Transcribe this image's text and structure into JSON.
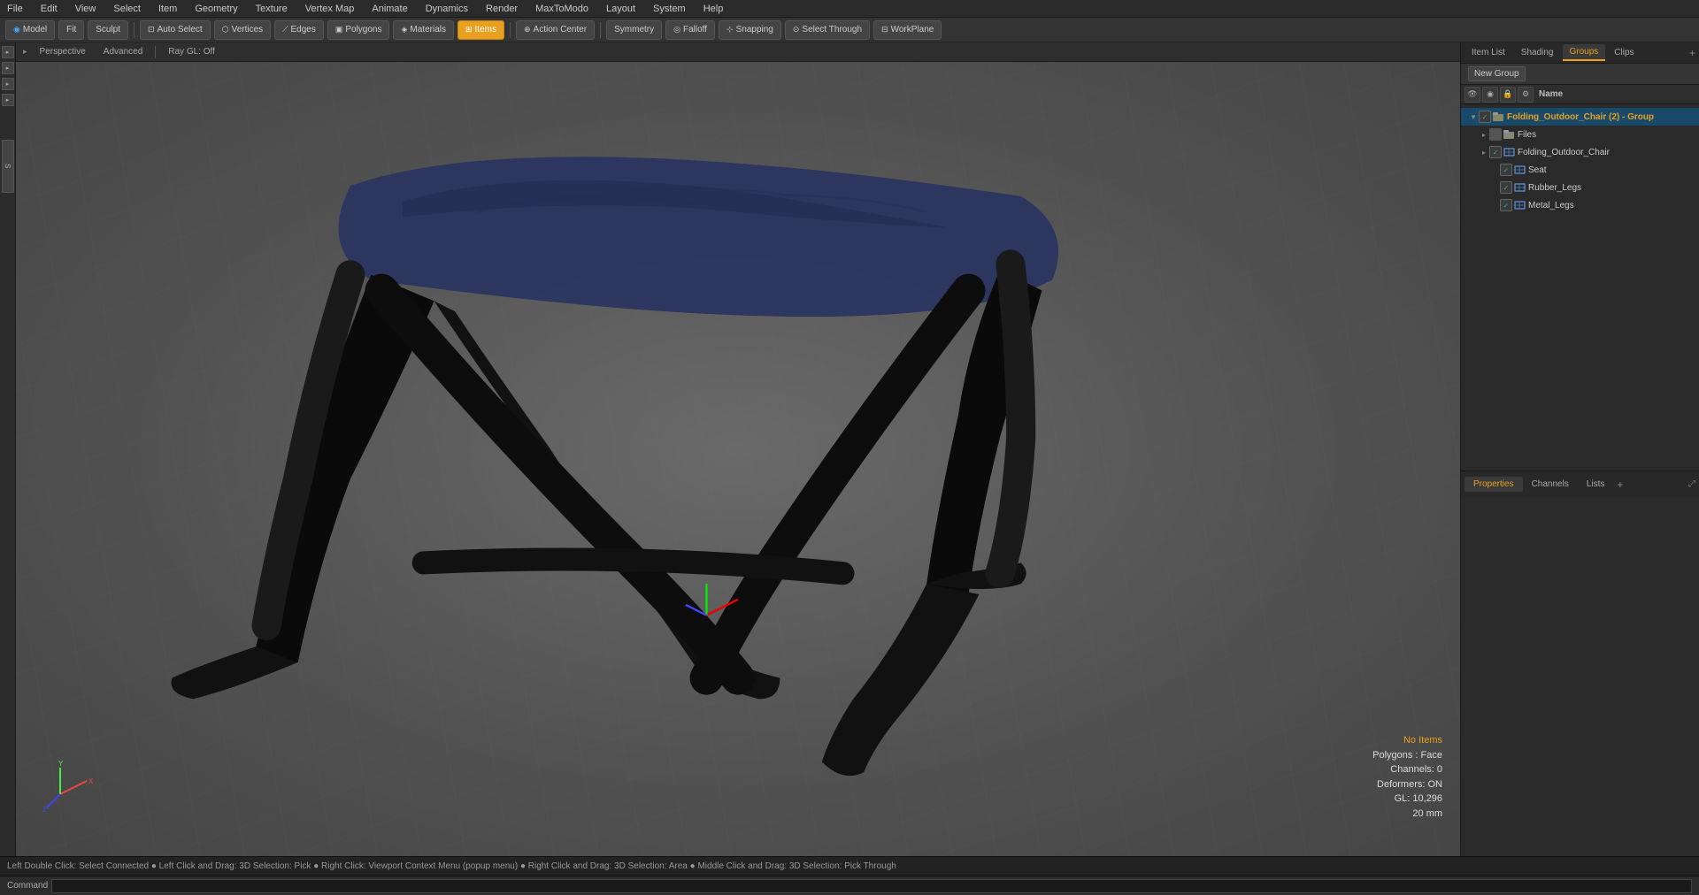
{
  "menu": {
    "items": [
      "File",
      "Edit",
      "View",
      "Select",
      "Item",
      "Geometry",
      "Texture",
      "Vertex Map",
      "Animate",
      "Dynamics",
      "Render",
      "MaxToModo",
      "Layout",
      "System",
      "Help"
    ]
  },
  "toolbar": {
    "mode_model": "Model",
    "mode_fit": "Fit",
    "mode_sculpt": "Sculpt",
    "auto_select": "Auto Select",
    "vertices": "Vertices",
    "edges": "Edges",
    "polygons": "Polygons",
    "materials": "Materials",
    "items": "Items",
    "action_center": "Action Center",
    "symmetry": "Symmetry",
    "falloff": "Falloff",
    "snapping": "Snapping",
    "select_through": "Select Through",
    "workplane": "WorkPlane"
  },
  "sub_toolbar": {
    "perspective": "Perspective",
    "advanced": "Advanced",
    "ray_gl": "Ray GL: Off"
  },
  "viewport": {
    "no_items": "No Items",
    "polygons": "Polygons : Face",
    "channels": "Channels: 0",
    "deformers": "Deformers: ON",
    "gl": "GL: 10,296",
    "size": "20 mm"
  },
  "status_bar": {
    "text": "Left Double Click: Select Connected ● Left Click and Drag: 3D Selection: Pick ● Right Click: Viewport Context Menu (popup menu) ● Right Click and Drag: 3D Selection: Area ● Middle Click and Drag: 3D Selection: Pick Through"
  },
  "command_bar": {
    "label": "Command",
    "placeholder": ""
  },
  "right_panel": {
    "tabs": [
      "Item List",
      "Shading",
      "Groups",
      "Clips"
    ],
    "active_tab": "Groups",
    "new_group_label": "New Group",
    "scene_header": "Name",
    "tree": [
      {
        "id": 1,
        "label": "Folding_Outdoor_Chair",
        "type": "group",
        "depth": 0,
        "suffix": "(2) - Group",
        "expanded": true,
        "checked": true
      },
      {
        "id": 2,
        "label": "Files",
        "type": "folder",
        "depth": 1,
        "expanded": false,
        "checked": false
      },
      {
        "id": 3,
        "label": "Folding_Outdoor_Chair",
        "type": "mesh",
        "depth": 1,
        "expanded": false,
        "checked": true
      },
      {
        "id": 4,
        "label": "Seat",
        "type": "mesh",
        "depth": 2,
        "expanded": false,
        "checked": true
      },
      {
        "id": 5,
        "label": "Rubber_Legs",
        "type": "mesh",
        "depth": 2,
        "expanded": false,
        "checked": true
      },
      {
        "id": 6,
        "label": "Metal_Legs",
        "type": "mesh",
        "depth": 2,
        "expanded": false,
        "checked": true
      }
    ],
    "bottom_tabs": [
      "Properties",
      "Channels",
      "Lists"
    ],
    "active_bottom_tab": "Properties"
  }
}
